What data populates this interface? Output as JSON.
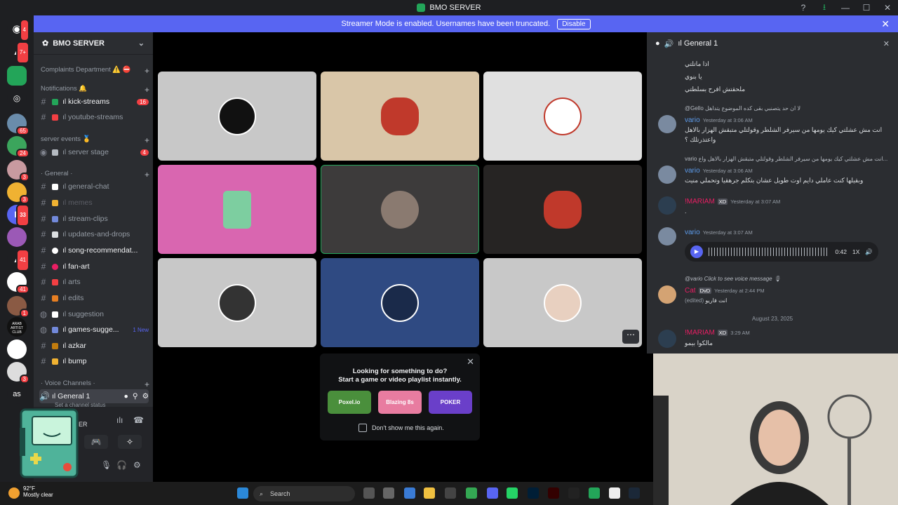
{
  "window": {
    "title": "BMO SERVER"
  },
  "banner": {
    "text": "Streamer Mode is enabled. Usernames have been truncated.",
    "disable": "Disable"
  },
  "server": {
    "name": "BMO SERVER"
  },
  "guild_badges": [
    "4",
    "7+",
    "65",
    "24",
    "3",
    "3",
    "33",
    "3",
    "41",
    "41",
    "1",
    "3"
  ],
  "guild_labels": {
    "arab_artist": "ARAB ARTIST CLUB",
    "as": "as"
  },
  "categories": {
    "complaints": "Complaints Department ⚠️ ⛔",
    "notifications": "Notifications 🔔",
    "server_events": "server events 🥇",
    "general": "· General ·",
    "voice": "· Voice Channels ·"
  },
  "channels": {
    "kick": "ıl kick-streams",
    "kick_badge": "16",
    "youtube": "ıl youtube-streams",
    "stage": "ıl server stage",
    "stage_badge": "4",
    "general_chat": "ıl general-chat",
    "memes": "ıl memes",
    "stream_clips": "ıl stream-clips",
    "updates": "ıl updates-and-drops",
    "song": "ıl song-recommendat...",
    "fan_art": "ıl fan-art",
    "arts": "ıl arts",
    "edits": "ıl edits",
    "suggestion": "ıl suggestion",
    "games": "ıl games-sugge...",
    "games_badge": "1 New",
    "azkar": "ıl azkar",
    "bump": "ıl bump",
    "voice_general": "ıl General 1",
    "voice_status": "Set a channel status"
  },
  "user_panel": {
    "name": "ER"
  },
  "activity": {
    "line1": "Looking for something to do?",
    "line2": "Start a game or video playlist instantly.",
    "games": [
      "Poxel.io",
      "Blazing 8s",
      "POKER"
    ],
    "dont_show": "Don't show me this again."
  },
  "chat": {
    "title": "ıl General 1",
    "lines_top": [
      "اذا ماتلتي",
      "يا بنوي",
      "ملحقتش افرح بسلطتي"
    ],
    "reply1": "@Gello لا ان حد يتصنبي بقى كده الموضوع يتداهل",
    "vario1_name": "vario",
    "vario1_time": "Yesterday at 3:06 AM",
    "vario1_text": "انت مش عشلتي كيك يومها من سيرفر الشلطر وقولتلي متبقش الهزار بالاهل",
    "vario1_text2": "واعتذرتلك ؟",
    "reply2": "vario انت مش عشلتي كيك يومها من سيرفر الشلطر وقولتلي متبقش الهزار بالاهل واع...",
    "vario2_name": "vario",
    "vario2_time": "Yesterday at 3:06 AM",
    "vario2_text": "وبقيلها كنت عاملي دايم اوت طويل عشان بتكلم جرهقيا وتحملي منيت",
    "mariam1_name": "!MARIAM",
    "mariam1_tag": "XD",
    "mariam1_time": "Yesterday at 3:07 AM",
    "mariam1_text": ".",
    "vario3_name": "vario",
    "vario3_time": "Yesterday at 3:07 AM",
    "voice_duration": "0:42",
    "voice_speed": "1X",
    "reply3": "@vario Click to see voice message 🎙",
    "cat_name": "Cat",
    "cat_tag": "DvD",
    "cat_time": "Yesterday at 2:44 PM",
    "cat_edited": "(edited)",
    "cat_text": "انت فاريو",
    "date_divider": "August 23, 2025",
    "mariam2_name": "!MARIAM",
    "mariam2_tag": "XD",
    "mariam2_time": "3:29 AM",
    "mariam2_text": "مالكوا بيمو"
  },
  "taskbar": {
    "temp": "92°F",
    "weather": "Mostly clear",
    "search": "Search"
  },
  "colors": {
    "accent": "#5865f2",
    "green": "#23a559",
    "red": "#f23f43",
    "bg": "#2b2d31"
  }
}
